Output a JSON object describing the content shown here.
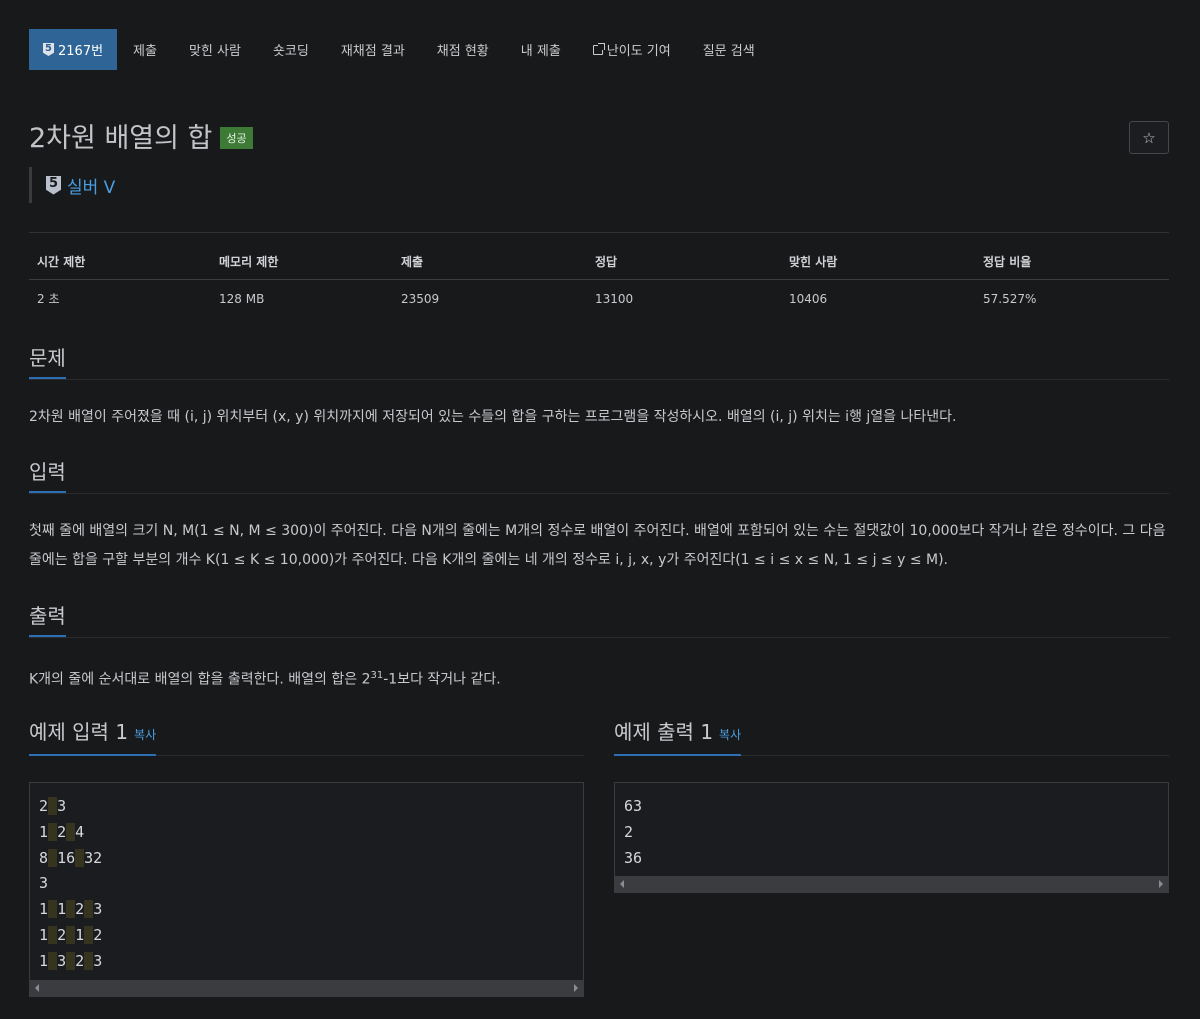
{
  "nav": {
    "problem_tab": {
      "tier": "5",
      "label": "2167번"
    },
    "items": [
      "제출",
      "맞힌 사람",
      "숏코딩",
      "재채점 결과",
      "채점 현황",
      "내 제출",
      "난이도 기여",
      "질문 검색"
    ]
  },
  "problem": {
    "title": "2차원 배열의 합",
    "status_label": "성공",
    "star_icon": "☆",
    "tier_number": "5",
    "tier_text": "실버 V"
  },
  "info_table": {
    "headers": [
      "시간 제한",
      "메모리 제한",
      "제출",
      "정답",
      "맞힌 사람",
      "정답 비율"
    ],
    "values": [
      "2 초",
      "128 MB",
      "23509",
      "13100",
      "10406",
      "57.527%"
    ]
  },
  "sections": {
    "description": {
      "heading": "문제",
      "text": "2차원 배열이 주어졌을 때 (i, j) 위치부터 (x, y) 위치까지에 저장되어 있는 수들의 합을 구하는 프로그램을 작성하시오. 배열의 (i, j) 위치는 i행 j열을 나타낸다."
    },
    "input": {
      "heading": "입력",
      "text": "첫째 줄에 배열의 크기 N, M(1 ≤ N, M ≤ 300)이 주어진다. 다음 N개의 줄에는 M개의 정수로 배열이 주어진다. 배열에 포함되어 있는 수는 절댓값이 10,000보다 작거나 같은 정수이다. 그 다음 줄에는 합을 구할 부분의 개수 K(1 ≤ K ≤ 10,000)가 주어진다. 다음 K개의 줄에는 네 개의 정수로 i, j, x, y가 주어진다(1 ≤ i ≤ x ≤ N, 1 ≤ j ≤ y ≤ M)."
    },
    "output": {
      "heading": "출력",
      "text_before": "K개의 줄에 순서대로 배열의 합을 출력한다. 배열의 합은 2",
      "sup": "31",
      "text_after": "-1보다 작거나 같다."
    }
  },
  "samples": {
    "input": {
      "heading": "예제 입력 1",
      "copy_label": "복사",
      "lines": [
        [
          "2",
          "3"
        ],
        [
          "1",
          "2",
          "4"
        ],
        [
          "8",
          "16",
          "32"
        ],
        [
          "3"
        ],
        [
          "1",
          "1",
          "2",
          "3"
        ],
        [
          "1",
          "2",
          "1",
          "2"
        ],
        [
          "1",
          "3",
          "2",
          "3"
        ]
      ]
    },
    "output": {
      "heading": "예제 출력 1",
      "copy_label": "복사",
      "lines": [
        [
          "63"
        ],
        [
          "2"
        ],
        [
          "36"
        ]
      ]
    }
  }
}
